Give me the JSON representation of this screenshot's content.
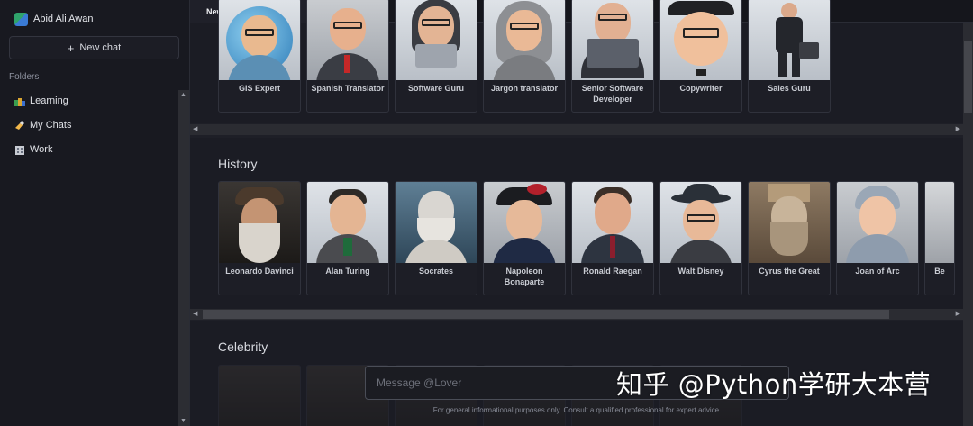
{
  "user": {
    "name": "Abid Ali Awan"
  },
  "sidebar": {
    "new_chat_label": "New chat",
    "folders_label": "Folders",
    "folders": [
      {
        "label": "Learning",
        "icon": "books-icon"
      },
      {
        "label": "My Chats",
        "icon": "writing-hand-icon"
      },
      {
        "label": "Work",
        "icon": "office-building-icon"
      }
    ]
  },
  "tabs": [
    {
      "label": "New chat"
    }
  ],
  "sections": [
    {
      "title": "",
      "cards": [
        {
          "name": "GIS Expert"
        },
        {
          "name": "Spanish Translator"
        },
        {
          "name": "Software Guru"
        },
        {
          "name": "Jargon translator"
        },
        {
          "name": "Senior Software Developer"
        },
        {
          "name": "Copywriter"
        },
        {
          "name": "Sales Guru"
        }
      ]
    },
    {
      "title": "History",
      "cards": [
        {
          "name": "Leonardo Davinci"
        },
        {
          "name": "Alan Turing"
        },
        {
          "name": "Socrates"
        },
        {
          "name": "Napoleon Bonaparte"
        },
        {
          "name": "Ronald Raegan"
        },
        {
          "name": "Walt Disney"
        },
        {
          "name": "Cyrus the Great"
        },
        {
          "name": "Joan of Arc"
        },
        {
          "name": "Be"
        }
      ]
    },
    {
      "title": "Celebrity",
      "cards": []
    }
  ],
  "composer": {
    "placeholder": "Message @Lover",
    "disclaimer": "For general informational purposes only. Consult a qualified professional for expert advice."
  },
  "watermark": "知乎 @Python学研大本营",
  "colors": {
    "background": "#1b1c24",
    "sidebar": "#181920",
    "accent": "#2fa36b"
  }
}
